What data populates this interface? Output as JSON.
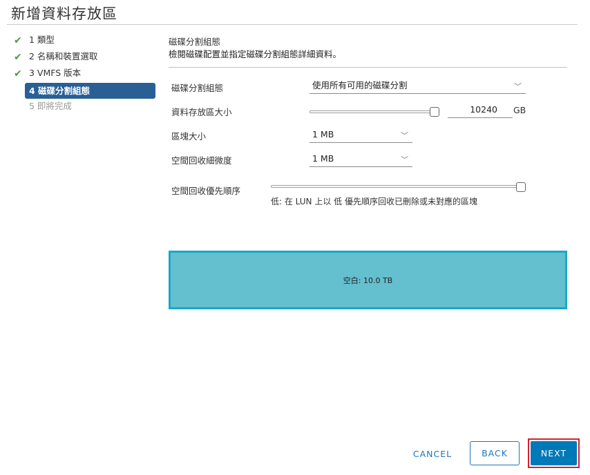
{
  "dialog": {
    "title": "新增資料存放區"
  },
  "steps": [
    {
      "label": "1 類型",
      "state": "done"
    },
    {
      "label": "2 名稱和裝置選取",
      "state": "done"
    },
    {
      "label": "3 VMFS 版本",
      "state": "done"
    },
    {
      "label": "4 磁碟分割組態",
      "state": "active"
    },
    {
      "label": "5 即將完成",
      "state": "pending"
    }
  ],
  "content": {
    "heading": "磁碟分割組態",
    "subheading": "檢閱磁碟配置並指定磁碟分割組態詳細資料。"
  },
  "form": {
    "partition_config": {
      "label": "磁碟分割組態",
      "value": "使用所有可用的磁碟分割"
    },
    "datastore_size": {
      "label": "資料存放區大小",
      "value": "10240",
      "unit": "GB",
      "slider_fraction": 1.0
    },
    "block_size": {
      "label": "區塊大小",
      "value": "1 MB"
    },
    "reclamation_granularity": {
      "label": "空間回收細微度",
      "value": "1 MB"
    },
    "reclamation_priority": {
      "label": "空間回收優先順序",
      "slider_fraction": 1.0,
      "hint": "低: 在 LUN 上以 低 優先順序回收已刪除或未對應的區塊"
    }
  },
  "capacity_bar": {
    "label": "空白: 10.0 TB",
    "color": "#64bfcf",
    "border_color": "#17a9c6"
  },
  "buttons": {
    "cancel": "CANCEL",
    "back": "BACK",
    "next": "NEXT"
  },
  "colors": {
    "accent": "#0079b8",
    "active_step": "#295f95",
    "check": "#4b9b3e",
    "highlight_border": "#d3212f"
  }
}
